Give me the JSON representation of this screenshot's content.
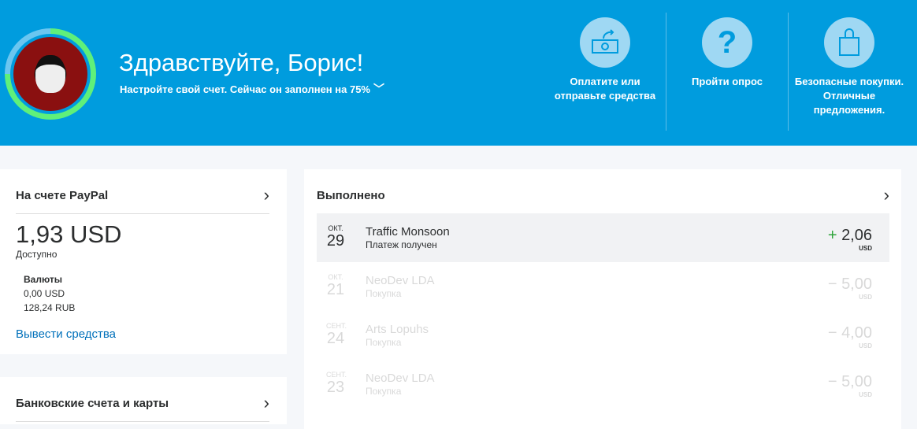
{
  "header": {
    "greeting": "Здравствуйте, Борис!",
    "profile_text": "Настройте свой счет. Сейчас он заполнен на 75%",
    "profile_progress": 0.75,
    "actions": [
      {
        "label": "Оплатите или отправьте средства",
        "icon": "money-send-icon"
      },
      {
        "label": "Пройти опрос",
        "icon": "question-icon"
      },
      {
        "label": "Безопасные покупки. Отличные предложения.",
        "icon": "shopping-bag-icon"
      }
    ]
  },
  "balance": {
    "title": "На счете PayPal",
    "amount": "1,93 USD",
    "available": "Доступно",
    "currencies_title": "Валюты",
    "currencies": [
      "0,00 USD",
      "128,24 RUB"
    ],
    "withdraw": "Вывести средства"
  },
  "banks": {
    "title": "Банковские счета и карты"
  },
  "activity": {
    "title": "Выполнено",
    "items": [
      {
        "month": "ОКТ.",
        "day": "29",
        "name": "Traffic Monsoon",
        "status": "Платеж получен",
        "sign": "+",
        "amount": "2,06",
        "currency": "USD"
      },
      {
        "month": "ОКТ.",
        "day": "21",
        "name": "NeoDev LDA",
        "status": "Покупка",
        "sign": "−",
        "amount": "5,00",
        "currency": "USD"
      },
      {
        "month": "СЕНТ.",
        "day": "24",
        "name": "Arts Lopuhs",
        "status": "Покупка",
        "sign": "−",
        "amount": "4,00",
        "currency": "USD"
      },
      {
        "month": "СЕНТ.",
        "day": "23",
        "name": "NeoDev LDA",
        "status": "Покупка",
        "sign": "−",
        "amount": "5,00",
        "currency": "USD"
      }
    ]
  }
}
